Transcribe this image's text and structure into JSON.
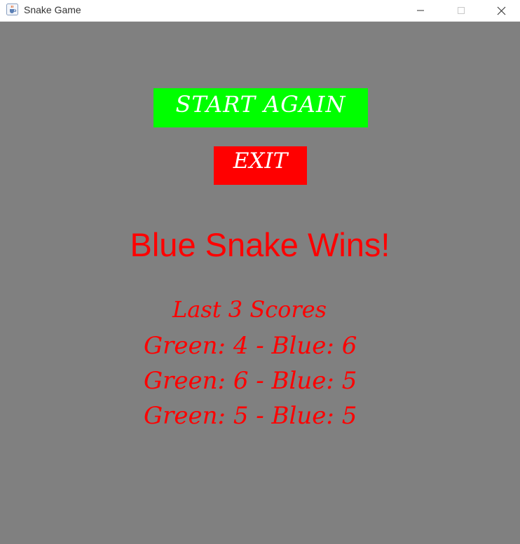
{
  "window": {
    "title": "Snake Game",
    "app_icon": "java-cup-icon",
    "controls": [
      "minimize-icon",
      "maximize-icon",
      "close-icon"
    ]
  },
  "menu": {
    "start_again_label": "START AGAIN",
    "exit_label": "EXIT"
  },
  "result": {
    "winner_text": "Blue Snake Wins!"
  },
  "scores": {
    "heading": "Last 3 Scores",
    "entries": [
      "Green: 4 - Blue: 6",
      "Green: 6 - Blue: 5",
      "Green: 5 - Blue: 5"
    ]
  },
  "colors": {
    "background": "#808080",
    "start_button": "#00ff00",
    "exit_button": "#ff0000",
    "text_accent": "#ff0000",
    "button_text": "#ffffff"
  }
}
